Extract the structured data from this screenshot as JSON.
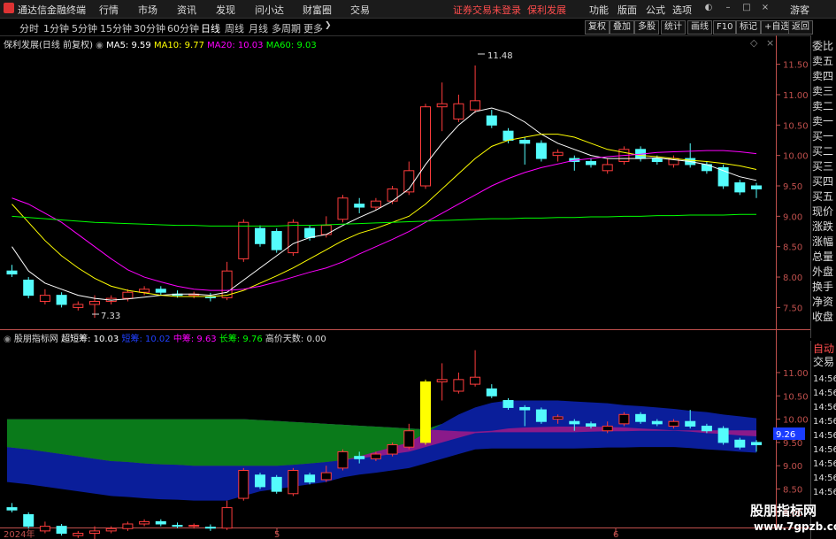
{
  "titlebar": {
    "app_title": "通达信金融终端",
    "menu": [
      "行情",
      "市场",
      "资讯",
      "发现",
      "问小达",
      "财富圈",
      "交易"
    ],
    "alert_text": "证券交易未登录",
    "alert_stock": "保利发展",
    "right_menu": [
      "功能",
      "版面",
      "公式",
      "选项"
    ],
    "guest_label": "游客"
  },
  "periodbar": {
    "periods": [
      "分时",
      "1分钟",
      "5分钟",
      "15分钟",
      "30分钟",
      "60分钟",
      "日线",
      "周线",
      "月线",
      "多周期",
      "更多"
    ],
    "active": "日线",
    "tools": [
      "复权",
      "叠加",
      "多股",
      "统计",
      "画线",
      "F10",
      "标记",
      "+自选",
      "返回"
    ]
  },
  "main_legend": {
    "stock": "保利发展(日线 前复权)",
    "ma5": "MA5: 9.59",
    "ma10": "MA10: 9.77",
    "ma20": "MA20: 10.03",
    "ma60": "MA60: 9.03"
  },
  "annotations": {
    "high": "11.48",
    "low": "7.33"
  },
  "sub_legend": {
    "name": "股朋指标网",
    "short": "超短筹: 10.03",
    "short2": "短筹: 10.02",
    "mid": "中筹: 9.63",
    "long": "长筹: 9.76",
    "days": "高价天数: 0.00"
  },
  "sub_value_badge": "9.26",
  "xaxis": [
    "2024年",
    "5",
    "6"
  ],
  "right_panel": [
    "委比",
    "卖五",
    "卖四",
    "卖三",
    "卖二",
    "卖一",
    "买一",
    "买二",
    "买三",
    "买四",
    "买五",
    "现价",
    "涨跌",
    "涨幅",
    "总量",
    "外盘",
    "换手",
    "净资",
    "收盘"
  ],
  "right_panel2": [
    "自动",
    "交易"
  ],
  "right_panel2_values": [
    "14:56",
    "14:56",
    "14:56",
    "14:56",
    "14:56",
    "14:56",
    "14:56",
    "14:56",
    "14:56"
  ],
  "watermark": {
    "line1": "股朋指标网",
    "line2": "www.7gpzb.com"
  },
  "colors": {
    "up": "#ff3c3c",
    "down": "#54fcfc",
    "ma5": "#ffffff",
    "ma10": "#ffff00",
    "ma20": "#ff00ff",
    "ma60": "#00ff00",
    "axis": "#c0504d"
  },
  "chart_data": [
    {
      "type": "candlestick",
      "yticks": [
        7.5,
        8.0,
        8.5,
        9.0,
        9.5,
        10.0,
        10.5,
        11.0,
        11.5
      ],
      "ylim": [
        7.2,
        11.8
      ],
      "candles": [
        {
          "o": 8.1,
          "c": 8.05,
          "h": 8.2,
          "l": 8.0
        },
        {
          "o": 7.95,
          "c": 7.7,
          "h": 8.0,
          "l": 7.65
        },
        {
          "o": 7.6,
          "c": 7.7,
          "h": 7.8,
          "l": 7.55
        },
        {
          "o": 7.7,
          "c": 7.55,
          "h": 7.75,
          "l": 7.5
        },
        {
          "o": 7.5,
          "c": 7.55,
          "h": 7.6,
          "l": 7.45
        },
        {
          "o": 7.55,
          "c": 7.6,
          "h": 7.7,
          "l": 7.33
        },
        {
          "o": 7.6,
          "c": 7.65,
          "h": 7.7,
          "l": 7.55
        },
        {
          "o": 7.65,
          "c": 7.75,
          "h": 7.8,
          "l": 7.6
        },
        {
          "o": 7.75,
          "c": 7.8,
          "h": 7.85,
          "l": 7.7
        },
        {
          "o": 7.8,
          "c": 7.75,
          "h": 7.85,
          "l": 7.7
        },
        {
          "o": 7.72,
          "c": 7.7,
          "h": 7.78,
          "l": 7.66
        },
        {
          "o": 7.7,
          "c": 7.72,
          "h": 7.76,
          "l": 7.65
        },
        {
          "o": 7.68,
          "c": 7.66,
          "h": 7.74,
          "l": 7.6
        },
        {
          "o": 7.66,
          "c": 8.1,
          "h": 8.25,
          "l": 7.62
        },
        {
          "o": 8.3,
          "c": 8.9,
          "h": 8.95,
          "l": 8.25
        },
        {
          "o": 8.8,
          "c": 8.55,
          "h": 8.85,
          "l": 8.5
        },
        {
          "o": 8.75,
          "c": 8.45,
          "h": 8.8,
          "l": 8.4
        },
        {
          "o": 8.4,
          "c": 8.9,
          "h": 8.95,
          "l": 8.35
        },
        {
          "o": 8.8,
          "c": 8.65,
          "h": 8.85,
          "l": 8.6
        },
        {
          "o": 8.7,
          "c": 8.85,
          "h": 9.0,
          "l": 8.65
        },
        {
          "o": 8.95,
          "c": 9.3,
          "h": 9.35,
          "l": 8.9
        },
        {
          "o": 9.2,
          "c": 9.15,
          "h": 9.3,
          "l": 9.05
        },
        {
          "o": 9.15,
          "c": 9.25,
          "h": 9.3,
          "l": 9.1
        },
        {
          "o": 9.25,
          "c": 9.45,
          "h": 9.5,
          "l": 9.2
        },
        {
          "o": 9.4,
          "c": 9.75,
          "h": 9.9,
          "l": 9.35
        },
        {
          "o": 9.5,
          "c": 10.8,
          "h": 10.85,
          "l": 9.45
        },
        {
          "o": 10.8,
          "c": 10.85,
          "h": 11.2,
          "l": 10.4
        },
        {
          "o": 10.6,
          "c": 10.85,
          "h": 11.0,
          "l": 10.55
        },
        {
          "o": 10.75,
          "c": 10.9,
          "h": 11.48,
          "l": 10.7
        },
        {
          "o": 10.65,
          "c": 10.5,
          "h": 10.75,
          "l": 10.45
        },
        {
          "o": 10.4,
          "c": 10.25,
          "h": 10.45,
          "l": 10.2
        },
        {
          "o": 10.25,
          "c": 10.2,
          "h": 10.3,
          "l": 9.85
        },
        {
          "o": 10.2,
          "c": 9.95,
          "h": 10.25,
          "l": 9.9
        },
        {
          "o": 10.0,
          "c": 10.05,
          "h": 10.1,
          "l": 9.9
        },
        {
          "o": 9.95,
          "c": 9.9,
          "h": 10.0,
          "l": 9.75
        },
        {
          "o": 9.9,
          "c": 9.85,
          "h": 9.95,
          "l": 9.8
        },
        {
          "o": 9.75,
          "c": 9.85,
          "h": 9.95,
          "l": 9.7
        },
        {
          "o": 9.9,
          "c": 10.1,
          "h": 10.15,
          "l": 9.85
        },
        {
          "o": 10.1,
          "c": 9.95,
          "h": 10.15,
          "l": 9.9
        },
        {
          "o": 9.95,
          "c": 9.9,
          "h": 10.0,
          "l": 9.85
        },
        {
          "o": 9.85,
          "c": 9.95,
          "h": 10.0,
          "l": 9.8
        },
        {
          "o": 9.95,
          "c": 9.85,
          "h": 10.2,
          "l": 9.8
        },
        {
          "o": 9.85,
          "c": 9.75,
          "h": 9.9,
          "l": 9.7
        },
        {
          "o": 9.8,
          "c": 9.5,
          "h": 9.85,
          "l": 9.45
        },
        {
          "o": 9.55,
          "c": 9.4,
          "h": 9.6,
          "l": 9.35
        },
        {
          "o": 9.5,
          "c": 9.45,
          "h": 9.55,
          "l": 9.3
        }
      ],
      "series": [
        {
          "name": "MA5",
          "values": [
            8.5,
            8.1,
            7.9,
            7.8,
            7.7,
            7.65,
            7.62,
            7.64,
            7.67,
            7.7,
            7.72,
            7.72,
            7.7,
            7.75,
            7.95,
            8.15,
            8.35,
            8.55,
            8.65,
            8.7,
            8.85,
            8.98,
            9.1,
            9.25,
            9.45,
            9.85,
            10.2,
            10.5,
            10.72,
            10.78,
            10.7,
            10.55,
            10.35,
            10.2,
            10.1,
            10.0,
            9.95,
            9.95,
            9.95,
            9.96,
            9.93,
            9.9,
            9.85,
            9.75,
            9.65,
            9.59
          ]
        },
        {
          "name": "MA10",
          "values": [
            9.2,
            8.9,
            8.6,
            8.35,
            8.15,
            7.98,
            7.85,
            7.78,
            7.74,
            7.7,
            7.68,
            7.68,
            7.68,
            7.7,
            7.78,
            7.9,
            8.02,
            8.15,
            8.3,
            8.45,
            8.6,
            8.72,
            8.8,
            8.9,
            9.0,
            9.2,
            9.45,
            9.7,
            9.95,
            10.15,
            10.25,
            10.3,
            10.35,
            10.35,
            10.3,
            10.2,
            10.1,
            10.05,
            10.0,
            9.98,
            9.95,
            9.92,
            9.9,
            9.87,
            9.83,
            9.77
          ]
        },
        {
          "name": "MA20",
          "values": [
            9.3,
            9.2,
            9.05,
            8.9,
            8.7,
            8.5,
            8.3,
            8.12,
            8.0,
            7.92,
            7.85,
            7.8,
            7.78,
            7.78,
            7.8,
            7.85,
            7.92,
            8.0,
            8.08,
            8.15,
            8.25,
            8.38,
            8.5,
            8.62,
            8.75,
            8.9,
            9.05,
            9.2,
            9.35,
            9.5,
            9.62,
            9.72,
            9.8,
            9.86,
            9.92,
            9.95,
            9.98,
            10.0,
            10.02,
            10.05,
            10.06,
            10.07,
            10.08,
            10.08,
            10.06,
            10.03
          ]
        },
        {
          "name": "MA60",
          "values": [
            9.0,
            8.98,
            8.96,
            8.94,
            8.92,
            8.9,
            8.89,
            8.88,
            8.87,
            8.86,
            8.85,
            8.85,
            8.84,
            8.84,
            8.84,
            8.84,
            8.84,
            8.85,
            8.85,
            8.86,
            8.87,
            8.88,
            8.89,
            8.9,
            8.91,
            8.92,
            8.93,
            8.94,
            8.95,
            8.96,
            8.96,
            8.97,
            8.97,
            8.98,
            8.98,
            8.99,
            8.99,
            9.0,
            9.0,
            9.01,
            9.01,
            9.02,
            9.02,
            9.02,
            9.03,
            9.03
          ]
        }
      ]
    },
    {
      "type": "area",
      "yticks": [
        8.0,
        8.5,
        9.0,
        9.5,
        10.0,
        10.5,
        11.0
      ],
      "ylim": [
        7.75,
        11.55
      ],
      "series": [
        {
          "name": "长筹",
          "values": [
            10.0,
            10.0,
            10.0,
            10.0,
            10.0,
            10.0,
            10.0,
            10.0,
            10.0,
            10.0,
            10.0,
            10.0,
            10.0,
            10.0,
            10.0,
            9.98,
            9.96,
            9.94,
            9.92,
            9.9,
            9.88,
            9.86,
            9.84,
            9.82,
            9.8,
            9.78,
            9.76,
            9.74,
            9.73,
            9.72,
            9.72,
            9.72,
            9.72,
            9.72,
            9.72,
            9.73,
            9.74,
            9.74,
            9.75,
            9.75,
            9.75,
            9.76,
            9.76,
            9.76,
            9.76,
            9.76
          ]
        },
        {
          "name": "中筹",
          "values": [
            9.4,
            9.35,
            9.3,
            9.25,
            9.2,
            9.15,
            9.1,
            9.08,
            9.05,
            9.03,
            9.02,
            9.0,
            9.0,
            9.0,
            9.0,
            9.0,
            9.0,
            9.02,
            9.05,
            9.08,
            9.12,
            9.16,
            9.2,
            9.25,
            9.3,
            9.4,
            9.5,
            9.6,
            9.7,
            9.75,
            9.8,
            9.82,
            9.83,
            9.84,
            9.84,
            9.84,
            9.83,
            9.82,
            9.8,
            9.78,
            9.76,
            9.73,
            9.7,
            9.68,
            9.65,
            9.63
          ]
        },
        {
          "name": "短筹",
          "values": [
            9.0,
            8.95,
            8.9,
            8.85,
            8.8,
            8.75,
            8.7,
            8.68,
            8.65,
            8.63,
            8.62,
            8.6,
            8.6,
            8.6,
            8.7,
            8.8,
            8.85,
            8.9,
            8.95,
            9.0,
            9.1,
            9.2,
            9.3,
            9.4,
            9.5,
            9.7,
            9.9,
            10.1,
            10.25,
            10.35,
            10.4,
            10.4,
            10.4,
            10.4,
            10.38,
            10.36,
            10.34,
            10.3,
            10.28,
            10.25,
            10.22,
            10.18,
            10.15,
            10.1,
            10.06,
            10.02
          ]
        }
      ],
      "candles_mirror": true
    }
  ]
}
